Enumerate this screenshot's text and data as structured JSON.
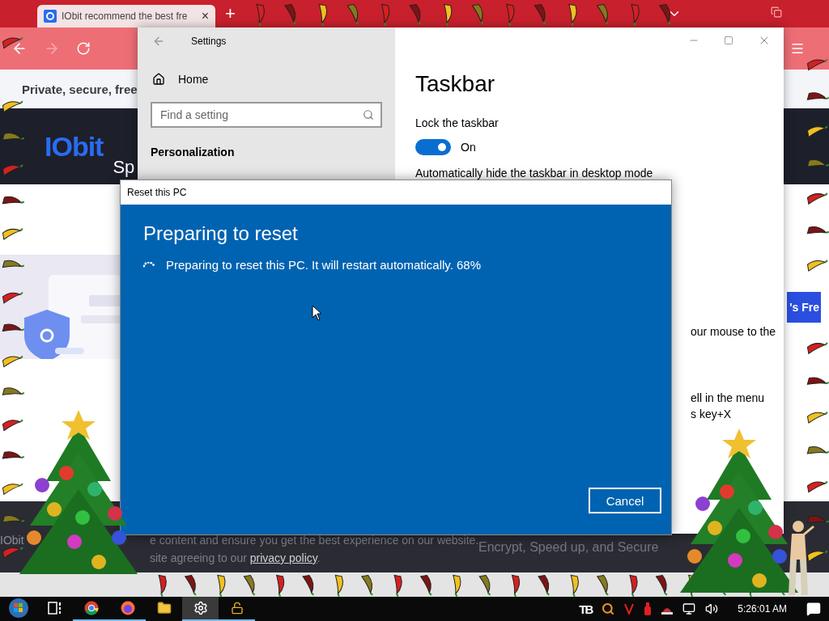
{
  "browser": {
    "tab": {
      "title": "IObit recommend the best fre",
      "close": "×",
      "selected": true
    },
    "new_tab": "+",
    "tagline": "Private, secure, free",
    "logo": "IObit",
    "hero_text": "Sp",
    "promo_button": "'s Fre",
    "cookie": {
      "logo": "IObit",
      "line_1": "e content and ensure you get the best experience on our website.",
      "line_2": "site agreeing to our",
      "link": "privacy policy",
      "line_2_end": "."
    },
    "side_text": "Encrypt, Speed up, and Secure"
  },
  "settings": {
    "title": "Settings",
    "nav": [
      {
        "label": "Home",
        "kind": "home"
      }
    ],
    "search": {
      "placeholder": "Find a setting"
    },
    "section": "Personalization",
    "page_title": "Taskbar",
    "options": [
      {
        "label": "Lock the taskbar",
        "on": true,
        "state": "On"
      }
    ],
    "hidden_label": "Automatically hide the taskbar in desktop mode",
    "cut_texts": [
      {
        "lines": [
          "our mouse to the"
        ]
      },
      {
        "lines": [
          "ell in the menu",
          "s key+X"
        ]
      }
    ]
  },
  "dialog": {
    "title": "Reset this PC",
    "heading": "Preparing to reset",
    "message": "Preparing to reset this PC. It will restart automatically. 68%",
    "button": "Cancel"
  },
  "taskbar": {
    "apps": [
      {
        "kind": "start",
        "running": false,
        "selected": false
      },
      {
        "kind": "taskview",
        "running": false,
        "selected": false
      },
      {
        "kind": "chrome",
        "running": true,
        "selected": false
      },
      {
        "kind": "firefox",
        "running": true,
        "selected": false
      },
      {
        "kind": "folder",
        "running": false,
        "selected": false
      },
      {
        "kind": "settings",
        "running": true,
        "selected": true
      },
      {
        "kind": "lock",
        "running": true,
        "selected": false
      }
    ],
    "tray_label": "TB",
    "clock": "5:26:01 AM"
  }
}
